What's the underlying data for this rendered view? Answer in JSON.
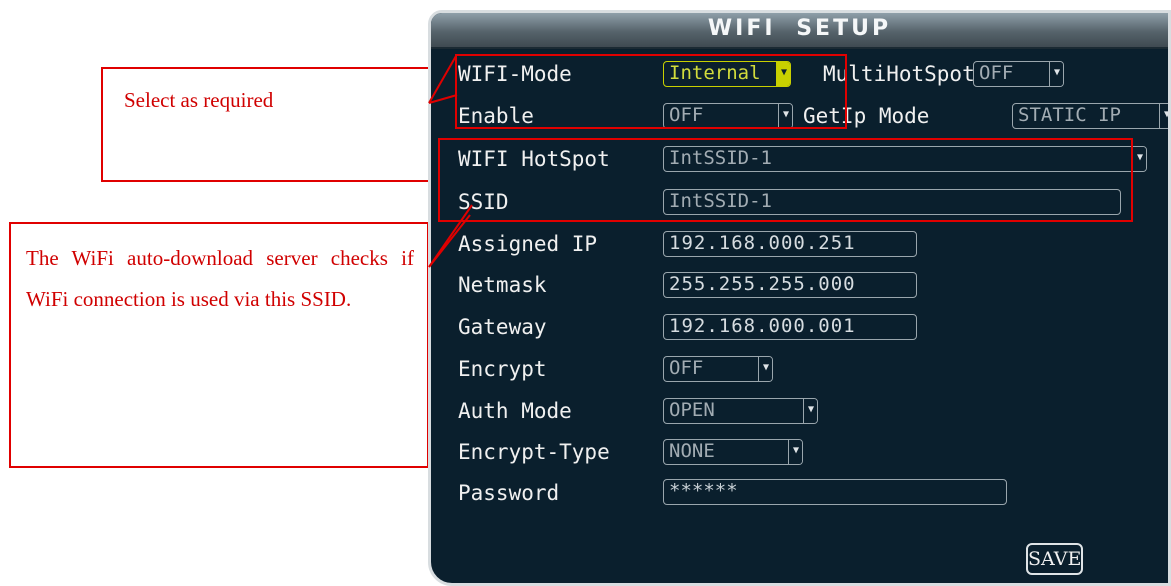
{
  "screen": {
    "title": "WIFI SETUP",
    "rows": {
      "wifi_mode": {
        "label": "WIFI-Mode",
        "value": "Internal"
      },
      "multihotspot": {
        "label": "MultiHotSpot",
        "value": "OFF"
      },
      "enable": {
        "label": "Enable",
        "value": "OFF"
      },
      "getip": {
        "label": "GetIp Mode",
        "value": "STATIC IP"
      },
      "hotspot": {
        "label": "WIFI HotSpot",
        "value": "IntSSID-1"
      },
      "ssid": {
        "label": "SSID",
        "value": "IntSSID-1"
      },
      "assigned_ip": {
        "label": "Assigned IP",
        "value": "192.168.000.251"
      },
      "netmask": {
        "label": "Netmask",
        "value": "255.255.255.000"
      },
      "gateway": {
        "label": "Gateway",
        "value": "192.168.000.001"
      },
      "encrypt": {
        "label": "Encrypt",
        "value": "OFF"
      },
      "auth_mode": {
        "label": "Auth Mode",
        "value": "OPEN"
      },
      "encrypt_type": {
        "label": "Encrypt-Type",
        "value": "NONE"
      },
      "password": {
        "label": "Password",
        "value": "******"
      }
    },
    "save_label": "SAVE"
  },
  "annotations": {
    "callout1": "Select as required",
    "callout2": "The WiFi auto-download server checks if WiFi connection is used via this SSID."
  },
  "colors": {
    "annotation": "#e00000",
    "screen_bg": "#0a1f2d",
    "active_field": "#c8d000"
  },
  "icons": {
    "dropdown": "dropdown-arrow-icon"
  }
}
